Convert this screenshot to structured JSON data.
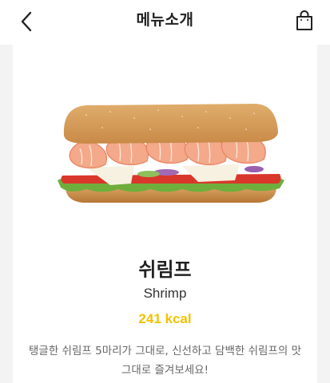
{
  "header": {
    "title": "메뉴소개",
    "back_icon": "chevron-left-icon",
    "cart_icon": "shopping-bag-icon"
  },
  "product": {
    "name": "쉬림프",
    "name_en": "Shrimp",
    "kcal": "241 kcal",
    "description": "탱글한 쉬림프 5마리가 그대로, 신선하고 담백한 쉬림프의 맛 그대로 즐겨보세요!",
    "image": "shrimp-sandwich-image"
  },
  "colors": {
    "accent": "#f2c200",
    "background": "#f3f3f3",
    "card": "#ffffff"
  }
}
